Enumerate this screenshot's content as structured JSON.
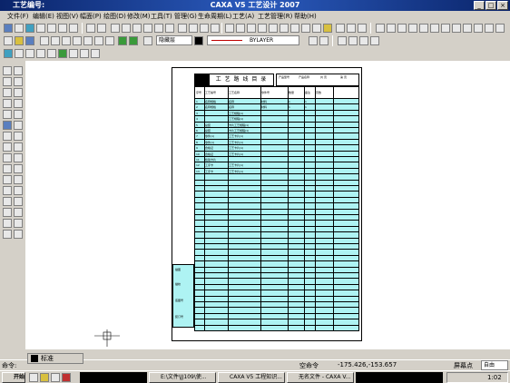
{
  "window": {
    "app_label": "工艺编号:",
    "title": "CAXA V5 工艺设计 2007",
    "min": "_",
    "max": "□",
    "close": "×"
  },
  "menus": [
    "文件(F)",
    "编辑(E)",
    "视图(V)",
    "幅面(P)",
    "绘图(D)",
    "修改(M)",
    "工具(T)",
    "管理(G)",
    "生命周期(L)",
    "工艺(A)",
    "工艺管理(R)",
    "帮助(H)"
  ],
  "layer_combo": "隐藏层",
  "linetype_combo": "BYLAYER",
  "sheet": {
    "title": "工 艺 路 线 目 录",
    "header_cells": [
      "产品型号",
      "产品名称",
      "共 页",
      "第 页"
    ],
    "columns": [
      "序号",
      "工艺编号",
      "工艺名称",
      "零件号",
      "数量",
      "备注",
      "页数"
    ],
    "rows": [
      [
        "1",
        "名称规格",
        "名称",
        "材料",
        "1",
        "1"
      ],
      [
        "2",
        "名称规格",
        "名称",
        "材料",
        "1",
        "1"
      ],
      [
        "3",
        "",
        "工艺规程(1)",
        "",
        "",
        ""
      ],
      [
        "4",
        "",
        "工艺规程(1)",
        "",
        "",
        ""
      ],
      [
        "5",
        "总装",
        "卡片工艺规程(1)",
        "",
        "",
        ""
      ],
      [
        "6",
        "总装",
        "卡片工艺规程(1)",
        "",
        "",
        ""
      ],
      [
        "7",
        "零件(1)",
        "工艺卡片(1)",
        "",
        "",
        ""
      ],
      [
        "8",
        "零件(1)",
        "工艺卡片(1)",
        "",
        "",
        ""
      ],
      [
        "9",
        "合格证",
        "工艺卡片(1)",
        "",
        "",
        ""
      ],
      [
        "10",
        "合格证",
        "工艺卡片(1)",
        "",
        "",
        ""
      ],
      [
        "11",
        "检验卡片",
        "",
        "",
        "",
        ""
      ],
      [
        "12",
        "工序卡",
        "工艺卡片(1)",
        "",
        "",
        ""
      ],
      [
        "13",
        "工序卡",
        "工艺卡片(1)",
        "",
        "",
        ""
      ]
    ],
    "footer_labels": [
      "描图",
      "描校",
      "底图号",
      "装订号"
    ]
  },
  "status": {
    "prompt_label": "命令:",
    "command": "空命令",
    "coords": "-175.426,-153.657",
    "screen_point": "屏幕点",
    "snap": "自由"
  },
  "sheet_tab": "标准",
  "taskbar": {
    "start": "开始",
    "tasks": [
      "E:\\文件\\JJ109\\使...",
      "CAXA V5 工程知识...",
      "无名文件 - CAXA V..."
    ],
    "time": "1:02"
  },
  "colors": {
    "title_bar": "#0a246a",
    "table_fill": "#aef3f3"
  }
}
